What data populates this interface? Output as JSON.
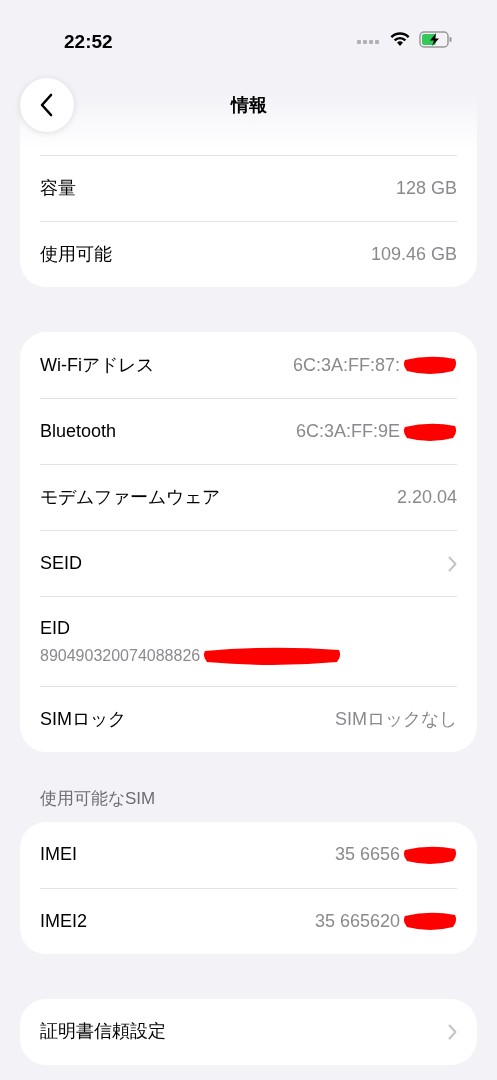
{
  "status_bar": {
    "time": "22:52"
  },
  "nav": {
    "title": "情報"
  },
  "sections": [
    {
      "rows": [
        {
          "kind": "value",
          "label": "容量",
          "value": "128 GB",
          "redacted": false
        },
        {
          "kind": "value",
          "label": "使用可能",
          "value": "109.46 GB",
          "redacted": false
        }
      ]
    },
    {
      "rows": [
        {
          "kind": "value",
          "label": "Wi-Fiアドレス",
          "value": "6C:3A:FF:87:",
          "redacted": true
        },
        {
          "kind": "value",
          "label": "Bluetooth",
          "value": "6C:3A:FF:9E",
          "redacted": true
        },
        {
          "kind": "value",
          "label": "モデムファームウェア",
          "value": "2.20.04",
          "redacted": false
        },
        {
          "kind": "link",
          "label": "SEID"
        },
        {
          "kind": "stacked",
          "label": "EID",
          "value": "890490320074088826",
          "redacted": true
        },
        {
          "kind": "value",
          "label": "SIMロック",
          "value": "SIMロックなし",
          "redacted": false
        }
      ]
    },
    {
      "header": "使用可能なSIM",
      "rows": [
        {
          "kind": "value",
          "label": "IMEI",
          "value": "35 6656",
          "redacted": true
        },
        {
          "kind": "value",
          "label": "IMEI2",
          "value": "35 665620",
          "redacted": true
        }
      ]
    },
    {
      "rows": [
        {
          "kind": "link",
          "label": "証明書信頼設定"
        }
      ]
    }
  ]
}
